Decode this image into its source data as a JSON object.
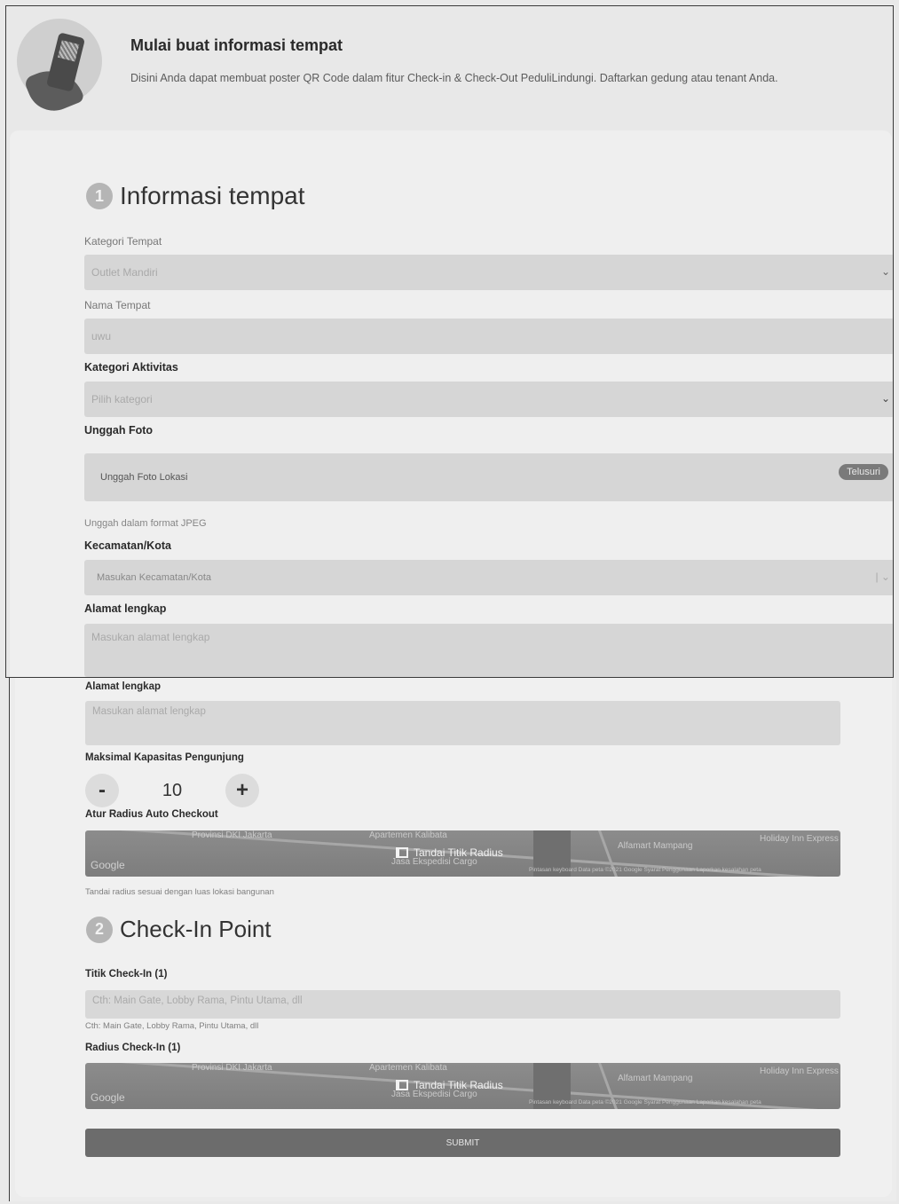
{
  "hero": {
    "title": "Mulai buat informasi tempat",
    "subtitle": "Disini Anda dapat membuat poster QR Code dalam fitur Check-in & Check-Out PeduliLindungi. Daftarkan gedung atau tenant Anda."
  },
  "section1": {
    "number": "1",
    "title": "Informasi tempat",
    "kategori_tempat": {
      "label": "Kategori Tempat",
      "value": "Outlet Mandiri"
    },
    "nama_tempat": {
      "label": "Nama Tempat",
      "value": "uwu"
    },
    "kategori_aktivitas": {
      "label": "Kategori Aktivitas",
      "placeholder": "Pilih kategori"
    },
    "unggah_foto": {
      "label": "Unggah Foto",
      "placeholder": "Unggah Foto Lokasi",
      "button": "Telusuri",
      "hint": "Unggah dalam format JPEG"
    },
    "kecamatan": {
      "label": "Kecamatan/Kota",
      "placeholder": "Masukan Kecamatan/Kota"
    },
    "alamat": {
      "label": "Alamat lengkap",
      "placeholder": "Masukan alamat lengkap"
    }
  },
  "continued": {
    "alamat": {
      "label": "Alamat lengkap",
      "placeholder": "Masukan alamat lengkap"
    },
    "kapasitas": {
      "label": "Maksimal Kapasitas Pengunjung",
      "minus": "-",
      "value": "10",
      "plus": "+"
    },
    "radius_auto": {
      "label": "Atur Radius Auto Checkout",
      "hint": "Tandai radius sesuai dengan luas lokasi bangunan"
    }
  },
  "map": {
    "button": "Tandai Titik Radius",
    "google": "Google",
    "labels": [
      "Provinsi DKI Jakarta",
      "Apartemen Kalibata",
      "Alfamart Mampang",
      "Holiday Inn Express",
      "Jasa Ekspedisi Cargo"
    ],
    "footer": "Pintasan keyboard   Data peta ©2021 Google   Syarat Penggunaan   Laporkan kesalahan peta"
  },
  "section2": {
    "number": "2",
    "title": "Check-In Point",
    "titik": {
      "label": "Titik Check-In (1)",
      "placeholder": "Cth: Main Gate, Lobby Rama, Pintu Utama, dll",
      "hint": "Cth: Main Gate, Lobby Rama, Pintu Utama, dll"
    },
    "radius": {
      "label": "Radius Check-In (1)"
    }
  },
  "submit": "SUBMIT"
}
